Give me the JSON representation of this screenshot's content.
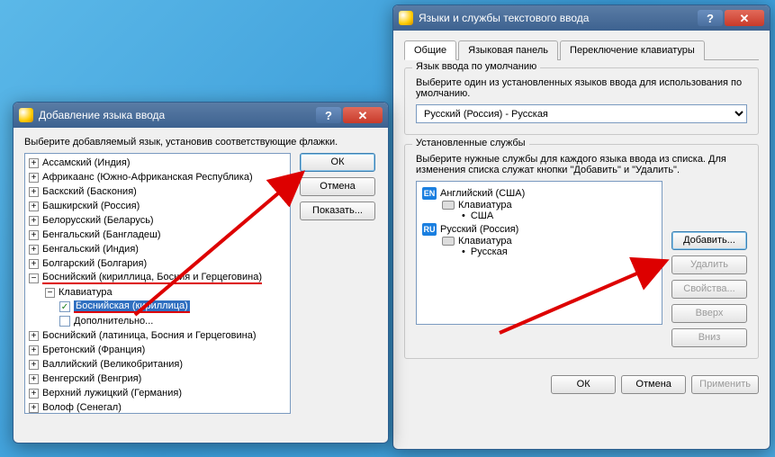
{
  "win2": {
    "title": "Языки и службы текстового ввода",
    "tabs": [
      "Общие",
      "Языковая панель",
      "Переключение клавиатуры"
    ],
    "group1": {
      "title": "Язык ввода по умолчанию",
      "text": "Выберите один из установленных языков ввода для использования по умолчанию.",
      "combo": "Русский (Россия) - Русская"
    },
    "group2": {
      "title": "Установленные службы",
      "text": "Выберите нужные службы для каждого языка ввода из списка. Для изменения списка служат кнопки \"Добавить\" и \"Удалить\".",
      "langs": [
        {
          "code": "EN",
          "name": "Английский (США)",
          "kbd": "Клавиатура",
          "layout": "США"
        },
        {
          "code": "RU",
          "name": "Русский (Россия)",
          "kbd": "Клавиатура",
          "layout": "Русская"
        }
      ],
      "btns": {
        "add": "Добавить...",
        "del": "Удалить",
        "props": "Свойства...",
        "up": "Вверх",
        "down": "Вниз"
      }
    },
    "footer": {
      "ok": "ОК",
      "cancel": "Отмена",
      "apply": "Применить"
    }
  },
  "win1": {
    "title": "Добавление языка ввода",
    "instr": "Выберите добавляемый язык, установив соответствующие флажки.",
    "btns": {
      "ok": "ОК",
      "cancel": "Отмена",
      "show": "Показать..."
    },
    "list": [
      "Ассамский (Индия)",
      "Африкаанс (Южно-Африканская Республика)",
      "Баскский (Баскония)",
      "Башкирский (Россия)",
      "Белорусский (Беларусь)",
      "Бенгальский (Бангладеш)",
      "Бенгальский (Индия)",
      "Болгарский (Болгария)",
      "Боснийский (кириллица, Босния и Герцеговина)",
      "Боснийский (латиница, Босния и Герцеговина)",
      "Бретонский (Франция)",
      "Валлийский (Великобритания)",
      "Венгерский (Венгрия)",
      "Верхний лужицкий (Германия)",
      "Волоф (Сенегал)"
    ],
    "expanded": {
      "kbd": "Клавиатура",
      "layout": "Боснийская (кириллица)",
      "more": "Дополнительно..."
    }
  }
}
